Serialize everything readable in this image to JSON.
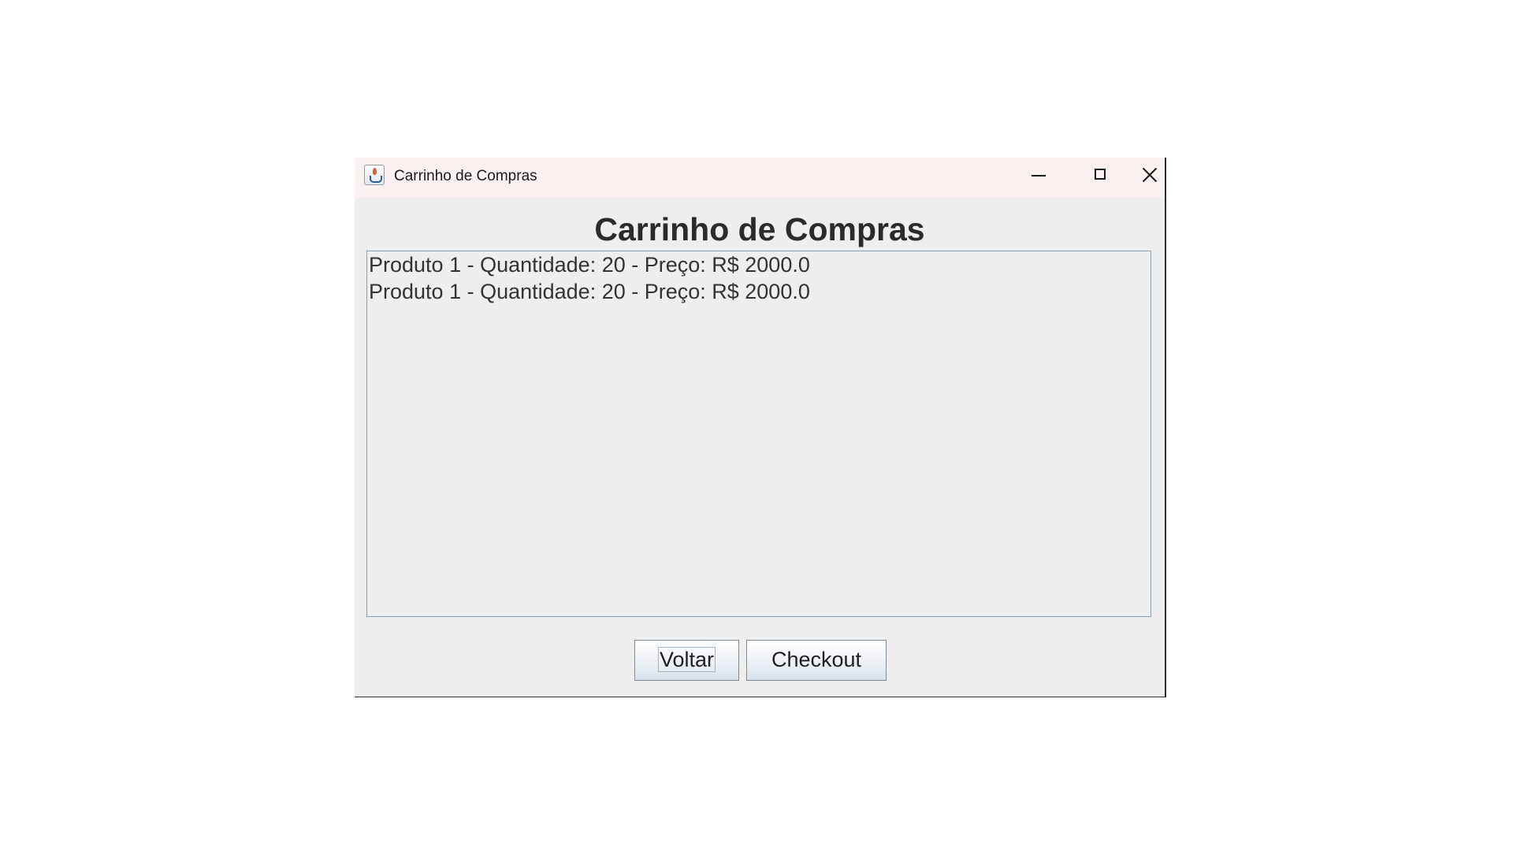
{
  "window": {
    "title": "Carrinho de Compras",
    "icon": "java-cup-icon"
  },
  "main": {
    "heading": "Carrinho de Compras",
    "cart_items": [
      "Produto 1 - Quantidade: 20 - Preço: R$ 2000.0",
      "Produto 1 - Quantidade: 20 - Preço: R$ 2000.0"
    ]
  },
  "buttons": {
    "back_label": "Voltar",
    "checkout_label": "Checkout",
    "focused": "Voltar"
  },
  "colors": {
    "titlebar": "#fbf1f1",
    "window_background": "#eeeeee",
    "list_border": "#8a9db1"
  }
}
